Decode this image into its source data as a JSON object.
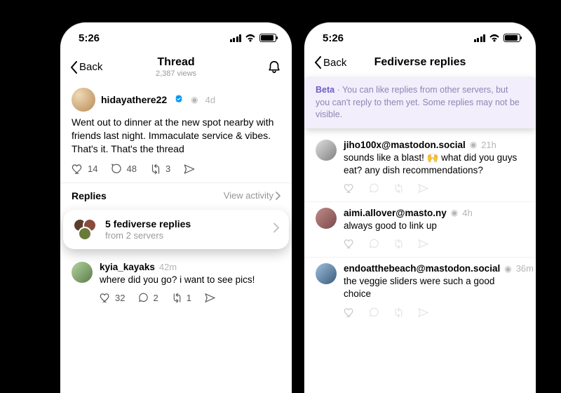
{
  "status": {
    "time": "5:26"
  },
  "left": {
    "nav": {
      "back": "Back",
      "title": "Thread",
      "subtitle": "2,387 views"
    },
    "post": {
      "username": "hidayathere22",
      "timestamp": "4d",
      "text": "Went out to dinner at the new spot nearby with friends last night. Immaculate service & vibes. That's it. That's the thread",
      "likes": "14",
      "comments": "48",
      "reposts": "3"
    },
    "replies_header": {
      "title": "Replies",
      "link": "View activity"
    },
    "fediverse": {
      "title": "5 fediverse replies",
      "subtitle": "from 2 servers"
    },
    "reply1": {
      "username": "kyia_kayaks",
      "timestamp": "42m",
      "text": "where did you go? i want to see pics!",
      "likes": "32",
      "comments": "2",
      "reposts": "1"
    }
  },
  "right": {
    "nav": {
      "back": "Back",
      "title": "Fediverse replies"
    },
    "banner": {
      "label": "Beta",
      "sep": " · ",
      "text": "You can like replies from other servers, but you can't reply to them yet. Some replies may not be visible."
    },
    "replies": [
      {
        "username": "jiho100x@mastodon.social",
        "timestamp": "21h",
        "text": "sounds like a blast! 🙌 what did you guys eat? any dish recommendations?"
      },
      {
        "username": "aimi.allover@masto.ny",
        "timestamp": "4h",
        "text": "always good to link up"
      },
      {
        "username": "endoatthebeach@mastodon.social",
        "timestamp": "36m",
        "text": "the veggie sliders were such a good choice"
      }
    ]
  }
}
